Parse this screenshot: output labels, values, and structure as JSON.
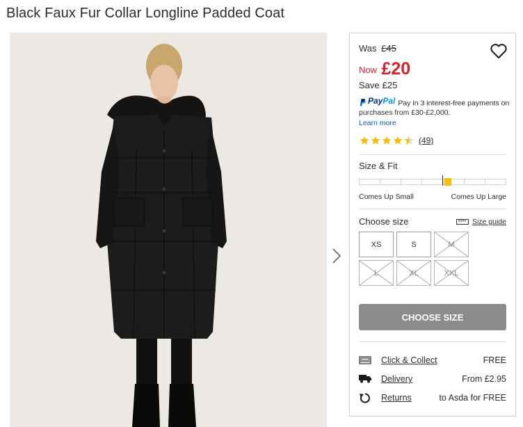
{
  "product": {
    "title": "Black Faux Fur Collar Longline Padded Coat"
  },
  "pricing": {
    "was_label": "Was",
    "was_price": "£45",
    "now_label": "Now",
    "now_price": "£20",
    "save_label": "Save",
    "save_amount": "£25"
  },
  "paypal": {
    "logo_pay": "Pay",
    "logo_pal": "Pal",
    "message": "Pay in 3 interest-free payments on purchases from £30-£2,000.",
    "learn_more": "Learn more"
  },
  "rating": {
    "stars": 4.5,
    "max_stars": 5,
    "count": "(49)"
  },
  "size_fit": {
    "title": "Size & Fit",
    "left_label": "Comes Up Small",
    "right_label": "Comes Up Large",
    "fit_position": 0.58,
    "segments": 7
  },
  "size_chooser": {
    "title": "Choose size",
    "size_guide": "Size guide",
    "sizes": [
      {
        "label": "XS",
        "available": true
      },
      {
        "label": "S",
        "available": true
      },
      {
        "label": "M",
        "available": false
      },
      {
        "label": "L",
        "available": false
      },
      {
        "label": "XL",
        "available": false
      },
      {
        "label": "XXL",
        "available": false
      }
    ]
  },
  "cta": {
    "label": "CHOOSE SIZE"
  },
  "delivery_options": [
    {
      "icon": "store-icon",
      "label": "Click & Collect",
      "value": "FREE"
    },
    {
      "icon": "truck-icon",
      "label": "Delivery",
      "value": "From £2.95"
    },
    {
      "icon": "returns-icon",
      "label": "Returns",
      "value": "to Asda for FREE"
    }
  ],
  "colors": {
    "sale_red": "#d9202f",
    "star_gold": "#f5c100",
    "link_blue": "#0b57a8",
    "cta_grey": "#8c8c8c"
  }
}
